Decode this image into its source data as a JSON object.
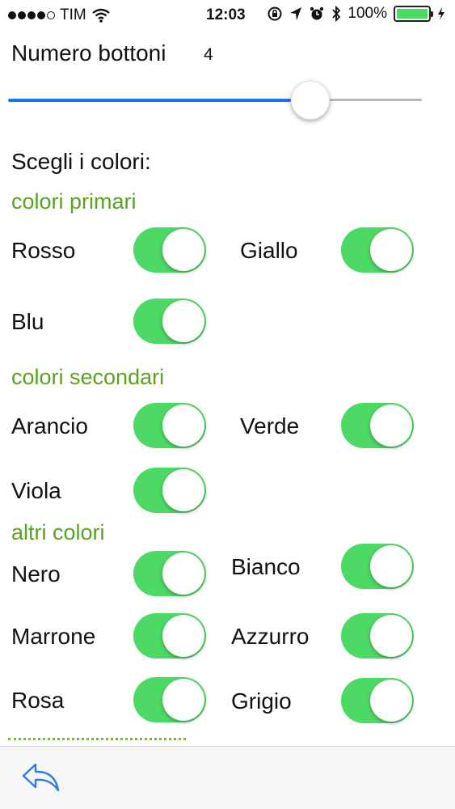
{
  "status_bar": {
    "carrier": "TIM",
    "time": "12:03",
    "battery": "100%",
    "signal_bars": 4,
    "battery_level": 1.0
  },
  "header": {
    "title": "Numero bottoni",
    "count": "4"
  },
  "slider": {
    "value_fraction": 0.73
  },
  "prompt": "Scegli i colori:",
  "sections": {
    "primary": {
      "title": "colori primari",
      "items": [
        {
          "label": "Rosso",
          "on": true
        },
        {
          "label": "Giallo",
          "on": true
        },
        {
          "label": "Blu",
          "on": true
        }
      ]
    },
    "secondary": {
      "title": "colori secondari",
      "items": [
        {
          "label": "Arancio",
          "on": true
        },
        {
          "label": "Verde",
          "on": true
        },
        {
          "label": "Viola",
          "on": true
        }
      ]
    },
    "other": {
      "title": "altri colori",
      "items": [
        {
          "label": "Nero",
          "on": true
        },
        {
          "label": "Bianco",
          "on": true
        },
        {
          "label": "Marrone",
          "on": true
        },
        {
          "label": "Azzurro",
          "on": true
        },
        {
          "label": "Rosa",
          "on": true
        },
        {
          "label": "Grigio",
          "on": true
        }
      ]
    }
  },
  "toolbar": {
    "back_icon": "reply-arrow-icon"
  },
  "colors": {
    "accent_blue": "#1a73e8",
    "switch_on": "#4cd964",
    "section_green": "#5aa31f"
  }
}
